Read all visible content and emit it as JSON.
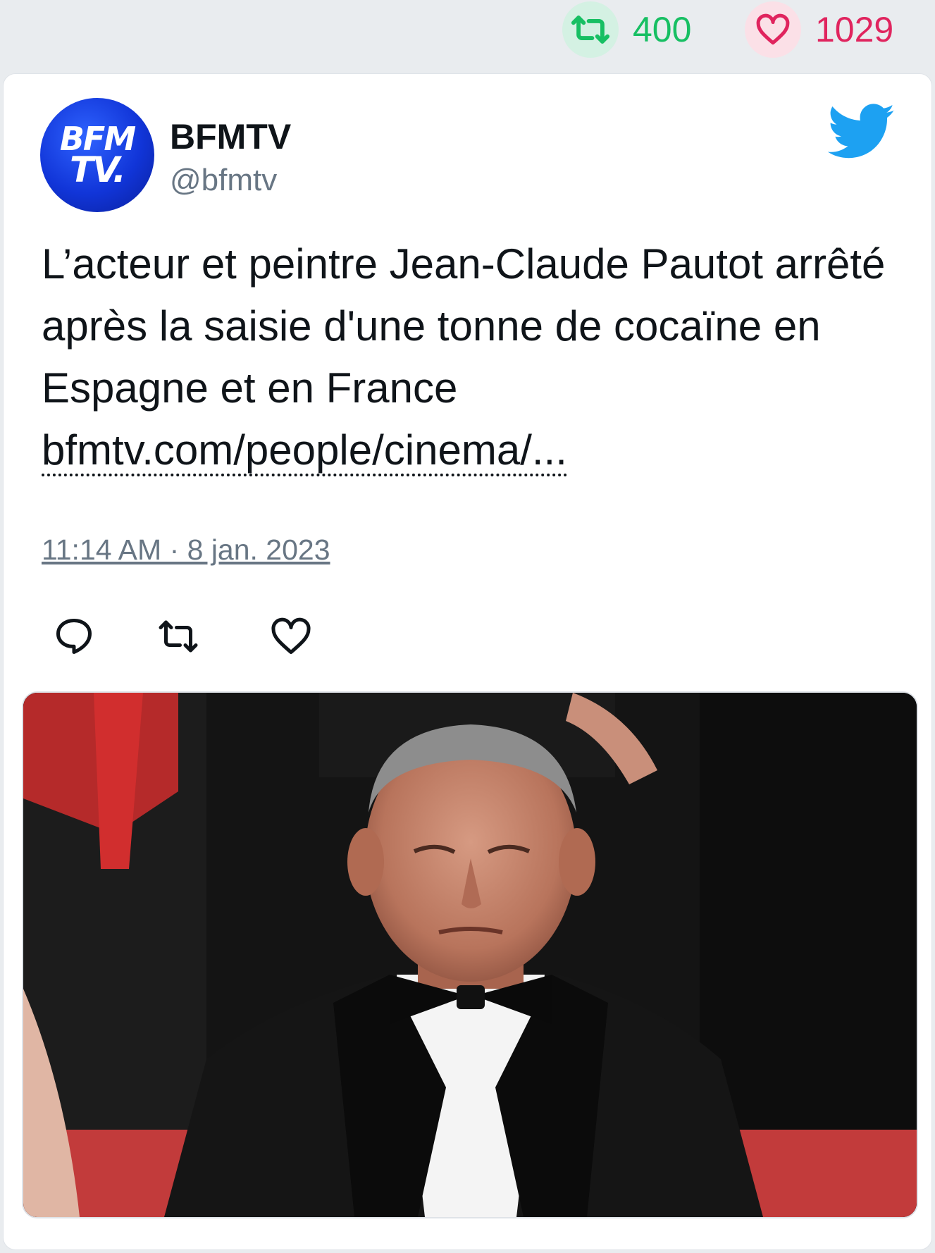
{
  "stats": {
    "retweets": "400",
    "likes": "1029",
    "retweet_color": "#17bf63",
    "like_color": "#e0245e"
  },
  "tweet": {
    "display_name": "BFMTV",
    "handle": "@bfmtv",
    "avatar_text": {
      "line1": "BFM",
      "line2": "TV."
    },
    "text": "L’acteur et peintre Jean-Claude Pautot arrêté après la saisie d'une tonne de cocaïne en Espagne et en France",
    "link": "bfmtv.com/people/cinema/...",
    "timestamp": "11:14 AM · 8 jan. 2023",
    "actions": [
      {
        "name": "reply",
        "icon": "reply-icon"
      },
      {
        "name": "retweet",
        "icon": "retweet-icon"
      },
      {
        "name": "like",
        "icon": "heart-icon"
      }
    ],
    "brand_icon": "twitter-bird-icon",
    "brand_color": "#1da1f2",
    "media_icon": "photo-man-in-tuxedo"
  }
}
